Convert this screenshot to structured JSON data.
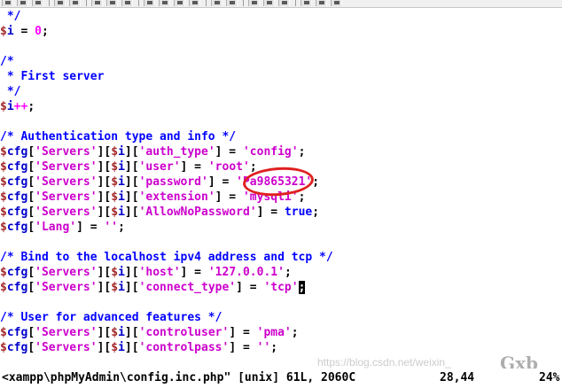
{
  "code_lines": [
    {
      "segments": [
        {
          "t": " */",
          "k": "com"
        }
      ]
    },
    {
      "segments": [
        {
          "t": "$",
          "k": "dollar"
        },
        {
          "t": "i",
          "k": "var"
        },
        {
          "t": " = ",
          "k": "op"
        },
        {
          "t": "0",
          "k": "num"
        },
        {
          "t": ";",
          "k": "op"
        }
      ]
    },
    {
      "segments": []
    },
    {
      "segments": [
        {
          "t": "/*",
          "k": "com"
        }
      ]
    },
    {
      "segments": [
        {
          "t": " * First server",
          "k": "com"
        }
      ]
    },
    {
      "segments": [
        {
          "t": " */",
          "k": "com"
        }
      ]
    },
    {
      "segments": [
        {
          "t": "$",
          "k": "dollar"
        },
        {
          "t": "i",
          "k": "var"
        },
        {
          "t": "++",
          "k": "num"
        },
        {
          "t": ";",
          "k": "op"
        }
      ]
    },
    {
      "segments": []
    },
    {
      "segments": [
        {
          "t": "/* Authentication type and info */",
          "k": "com"
        }
      ]
    },
    {
      "segments": [
        {
          "t": "$",
          "k": "dollar"
        },
        {
          "t": "cfg",
          "k": "var"
        },
        {
          "t": "[",
          "k": "op"
        },
        {
          "t": "'Servers'",
          "k": "str"
        },
        {
          "t": "][",
          "k": "op"
        },
        {
          "t": "$",
          "k": "dollar"
        },
        {
          "t": "i",
          "k": "var"
        },
        {
          "t": "][",
          "k": "op"
        },
        {
          "t": "'auth_type'",
          "k": "str"
        },
        {
          "t": "] = ",
          "k": "op"
        },
        {
          "t": "'config'",
          "k": "str"
        },
        {
          "t": ";",
          "k": "op"
        }
      ]
    },
    {
      "segments": [
        {
          "t": "$",
          "k": "dollar"
        },
        {
          "t": "cfg",
          "k": "var"
        },
        {
          "t": "[",
          "k": "op"
        },
        {
          "t": "'Servers'",
          "k": "str"
        },
        {
          "t": "][",
          "k": "op"
        },
        {
          "t": "$",
          "k": "dollar"
        },
        {
          "t": "i",
          "k": "var"
        },
        {
          "t": "][",
          "k": "op"
        },
        {
          "t": "'user'",
          "k": "str"
        },
        {
          "t": "] = ",
          "k": "op"
        },
        {
          "t": "'root'",
          "k": "str"
        },
        {
          "t": ";",
          "k": "op"
        }
      ]
    },
    {
      "segments": [
        {
          "t": "$",
          "k": "dollar"
        },
        {
          "t": "cfg",
          "k": "var"
        },
        {
          "t": "[",
          "k": "op"
        },
        {
          "t": "'Servers'",
          "k": "str"
        },
        {
          "t": "][",
          "k": "op"
        },
        {
          "t": "$",
          "k": "dollar"
        },
        {
          "t": "i",
          "k": "var"
        },
        {
          "t": "][",
          "k": "op"
        },
        {
          "t": "'password'",
          "k": "str"
        },
        {
          "t": "] = ",
          "k": "op"
        },
        {
          "t": "'Pa9865321'",
          "k": "str"
        },
        {
          "t": ";",
          "k": "op"
        }
      ]
    },
    {
      "segments": [
        {
          "t": "$",
          "k": "dollar"
        },
        {
          "t": "cfg",
          "k": "var"
        },
        {
          "t": "[",
          "k": "op"
        },
        {
          "t": "'Servers'",
          "k": "str"
        },
        {
          "t": "][",
          "k": "op"
        },
        {
          "t": "$",
          "k": "dollar"
        },
        {
          "t": "i",
          "k": "var"
        },
        {
          "t": "][",
          "k": "op"
        },
        {
          "t": "'extension'",
          "k": "str"
        },
        {
          "t": "] = ",
          "k": "op"
        },
        {
          "t": "'mysqli'",
          "k": "str"
        },
        {
          "t": ";",
          "k": "op"
        }
      ]
    },
    {
      "segments": [
        {
          "t": "$",
          "k": "dollar"
        },
        {
          "t": "cfg",
          "k": "var"
        },
        {
          "t": "[",
          "k": "op"
        },
        {
          "t": "'Servers'",
          "k": "str"
        },
        {
          "t": "][",
          "k": "op"
        },
        {
          "t": "$",
          "k": "dollar"
        },
        {
          "t": "i",
          "k": "var"
        },
        {
          "t": "][",
          "k": "op"
        },
        {
          "t": "'AllowNoPassword'",
          "k": "str"
        },
        {
          "t": "] = ",
          "k": "op"
        },
        {
          "t": "true",
          "k": "kw"
        },
        {
          "t": ";",
          "k": "op"
        }
      ]
    },
    {
      "segments": [
        {
          "t": "$",
          "k": "dollar"
        },
        {
          "t": "cfg",
          "k": "var"
        },
        {
          "t": "[",
          "k": "op"
        },
        {
          "t": "'Lang'",
          "k": "str"
        },
        {
          "t": "] = ",
          "k": "op"
        },
        {
          "t": "''",
          "k": "str"
        },
        {
          "t": ";",
          "k": "op"
        }
      ]
    },
    {
      "segments": []
    },
    {
      "segments": [
        {
          "t": "/* Bind to the localhost ipv4 address and tcp */",
          "k": "com"
        }
      ]
    },
    {
      "segments": [
        {
          "t": "$",
          "k": "dollar"
        },
        {
          "t": "cfg",
          "k": "var"
        },
        {
          "t": "[",
          "k": "op"
        },
        {
          "t": "'Servers'",
          "k": "str"
        },
        {
          "t": "][",
          "k": "op"
        },
        {
          "t": "$",
          "k": "dollar"
        },
        {
          "t": "i",
          "k": "var"
        },
        {
          "t": "][",
          "k": "op"
        },
        {
          "t": "'host'",
          "k": "str"
        },
        {
          "t": "] = ",
          "k": "op"
        },
        {
          "t": "'127.0.0.1'",
          "k": "str"
        },
        {
          "t": ";",
          "k": "op"
        }
      ]
    },
    {
      "segments": [
        {
          "t": "$",
          "k": "dollar"
        },
        {
          "t": "cfg",
          "k": "var"
        },
        {
          "t": "[",
          "k": "op"
        },
        {
          "t": "'Servers'",
          "k": "str"
        },
        {
          "t": "][",
          "k": "op"
        },
        {
          "t": "$",
          "k": "dollar"
        },
        {
          "t": "i",
          "k": "var"
        },
        {
          "t": "][",
          "k": "op"
        },
        {
          "t": "'connect_type'",
          "k": "str"
        },
        {
          "t": "] = ",
          "k": "op"
        },
        {
          "t": "'tcp'",
          "k": "str"
        },
        {
          "t": ";",
          "k": "cursor"
        }
      ]
    },
    {
      "segments": []
    },
    {
      "segments": [
        {
          "t": "/* User for advanced features */",
          "k": "com"
        }
      ]
    },
    {
      "segments": [
        {
          "t": "$",
          "k": "dollar"
        },
        {
          "t": "cfg",
          "k": "var"
        },
        {
          "t": "[",
          "k": "op"
        },
        {
          "t": "'Servers'",
          "k": "str"
        },
        {
          "t": "][",
          "k": "op"
        },
        {
          "t": "$",
          "k": "dollar"
        },
        {
          "t": "i",
          "k": "var"
        },
        {
          "t": "][",
          "k": "op"
        },
        {
          "t": "'controluser'",
          "k": "str"
        },
        {
          "t": "] = ",
          "k": "op"
        },
        {
          "t": "'pma'",
          "k": "str"
        },
        {
          "t": ";",
          "k": "op"
        }
      ]
    },
    {
      "segments": [
        {
          "t": "$",
          "k": "dollar"
        },
        {
          "t": "cfg",
          "k": "var"
        },
        {
          "t": "[",
          "k": "op"
        },
        {
          "t": "'Servers'",
          "k": "str"
        },
        {
          "t": "][",
          "k": "op"
        },
        {
          "t": "$",
          "k": "dollar"
        },
        {
          "t": "i",
          "k": "var"
        },
        {
          "t": "][",
          "k": "op"
        },
        {
          "t": "'controlpass'",
          "k": "str"
        },
        {
          "t": "] = ",
          "k": "op"
        },
        {
          "t": "''",
          "k": "str"
        },
        {
          "t": ";",
          "k": "op"
        }
      ]
    }
  ],
  "statusbar": {
    "file_info": "<xampp\\phpMyAdmin\\config.inc.php\" [unix] 61L, 2060C",
    "cursor_position": "28,44",
    "scroll_percent": "24%"
  },
  "watermark": {
    "text": "https://blog.csdn.net/weixin_",
    "logo_text": "Gxb"
  },
  "colors": {
    "comment": "#0000ff",
    "string": "#cc00cc",
    "variable": "#0000cc",
    "dollar": "#a52a2a",
    "highlight_ring": "#e02020"
  },
  "toolbar": {
    "icons": [
      "open-icon",
      "save-icon",
      "print-icon",
      "undo-icon",
      "redo-icon",
      "cut-icon",
      "copy-icon",
      "paste-icon",
      "find-icon",
      "replace-icon",
      "find-prev-icon",
      "find-next-icon",
      "session-load-icon",
      "session-save-icon",
      "script-icon",
      "make-icon",
      "shell-icon",
      "tag-icon",
      "help-icon",
      "find-help-icon"
    ]
  }
}
